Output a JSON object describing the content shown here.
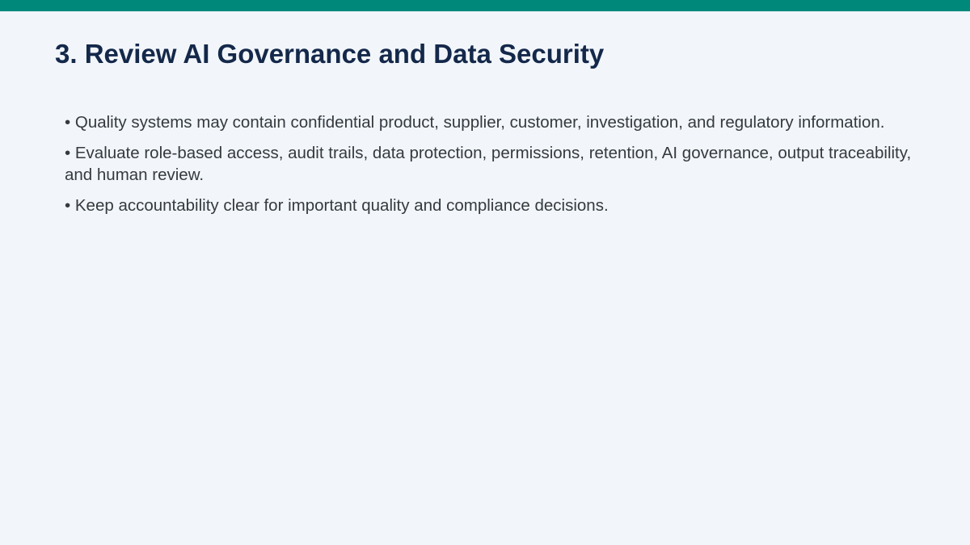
{
  "slide": {
    "accent_color": "#00897b",
    "title": "3. Review AI Governance and Data Security",
    "bullets": [
      "• Quality systems may contain confidential product, supplier, customer, investigation, and regulatory information.",
      "• Evaluate role-based access, audit trails, data protection, permissions, retention, AI governance, output traceability, and human review.",
      "• Keep accountability clear for important quality and compliance decisions."
    ]
  }
}
